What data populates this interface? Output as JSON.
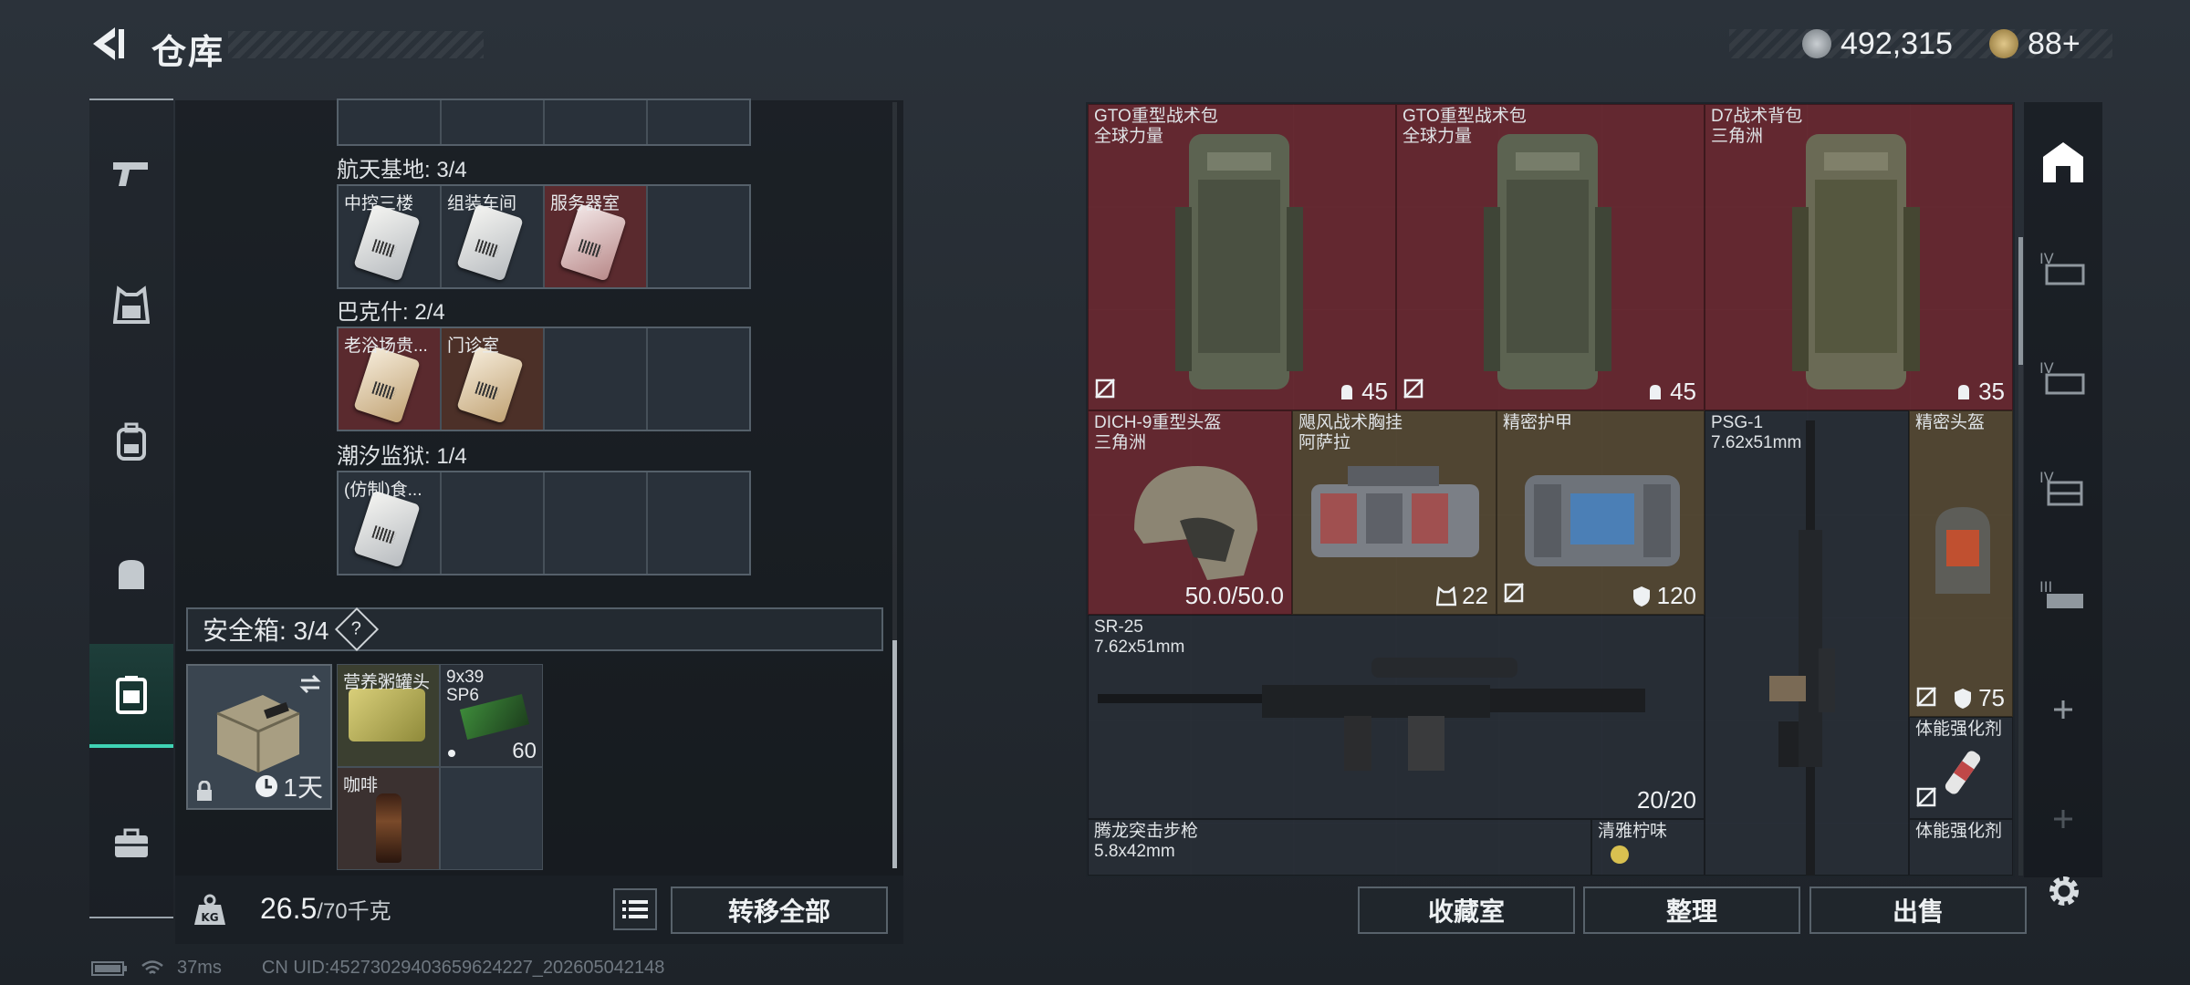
{
  "header": {
    "title": "仓库"
  },
  "currency": {
    "coins": "492,315",
    "tokens": "88+"
  },
  "left_nav": [
    "gun-icon",
    "armor-icon",
    "backpack-icon",
    "bag-icon",
    "safebox-icon",
    "toolbox-icon"
  ],
  "keycard_groups": [
    {
      "label": "航天基地: 3/4",
      "cells": [
        {
          "name": "中控三楼",
          "color": "gray"
        },
        {
          "name": "组装车间",
          "color": "gray"
        },
        {
          "name": "服务器室",
          "color": "red"
        },
        {
          "name": "",
          "color": "empty"
        }
      ]
    },
    {
      "label": "巴克什: 2/4",
      "cells": [
        {
          "name": "老浴场贵...",
          "color": "red"
        },
        {
          "name": "门诊室",
          "color": "brown"
        },
        {
          "name": "",
          "color": "empty"
        },
        {
          "name": "",
          "color": "empty"
        }
      ]
    },
    {
      "label": "潮汐监狱: 1/4",
      "cells": [
        {
          "name": "(仿制)食...",
          "color": "gray"
        },
        {
          "name": "",
          "color": "empty"
        },
        {
          "name": "",
          "color": "empty"
        },
        {
          "name": "",
          "color": "empty"
        }
      ]
    }
  ],
  "safe_box": {
    "label": "安全箱: 3/4",
    "help": "?",
    "timer": "1天",
    "items": [
      {
        "name": "营养粥罐头"
      },
      {
        "name": "9x39\nSP6",
        "count": "60"
      },
      {
        "name": "咖啡"
      }
    ]
  },
  "bottom": {
    "weight_current": "26.5",
    "weight_max": "/70千克",
    "transfer_all": "转移全部"
  },
  "stash_items": [
    {
      "name": "GTO重型战术包",
      "sub": "全球力量",
      "value": "45"
    },
    {
      "name": "GTO重型战术包",
      "sub": "全球力量",
      "value": "45"
    },
    {
      "name": "D7战术背包",
      "sub": "三角洲",
      "value": "35"
    },
    {
      "name": "DICH-9重型头盔",
      "sub": "三角洲",
      "value": "50.0/50.0"
    },
    {
      "name": "飓风战术胸挂",
      "sub": "阿萨拉",
      "value": "22"
    },
    {
      "name": "精密护甲",
      "sub": "",
      "value": "120"
    },
    {
      "name": "PSG-1",
      "sub": "7.62x51mm",
      "value": ""
    },
    {
      "name": "精密头盔",
      "sub": "",
      "value": "75"
    },
    {
      "name": "SR-25",
      "sub": "7.62x51mm",
      "value": "20/20"
    },
    {
      "name": "体能强化剂",
      "sub": "",
      "value": ""
    },
    {
      "name": "腾龙突击步枪",
      "sub": "5.8x42mm",
      "value": ""
    },
    {
      "name": "清雅柠味",
      "sub": "",
      "value": ""
    },
    {
      "name": "体能强化剂",
      "sub": "",
      "value": ""
    }
  ],
  "right_buttons": {
    "collection": "收藏室",
    "sort": "整理",
    "sell": "出售"
  },
  "right_nav": [
    "vault-icon",
    "tier4-gun-icon",
    "tier4-gun-icon",
    "tier4-case-icon",
    "tier3-gun-icon",
    "plus-icon",
    "plus-icon",
    "settings-icon"
  ],
  "footer": {
    "ping": "37ms",
    "uid": "CN UID:45273029403659624227_202605042148"
  },
  "colors": {
    "accent": "#3fd3b4",
    "red_item": "#6e2830",
    "olive_item": "#584a32"
  }
}
